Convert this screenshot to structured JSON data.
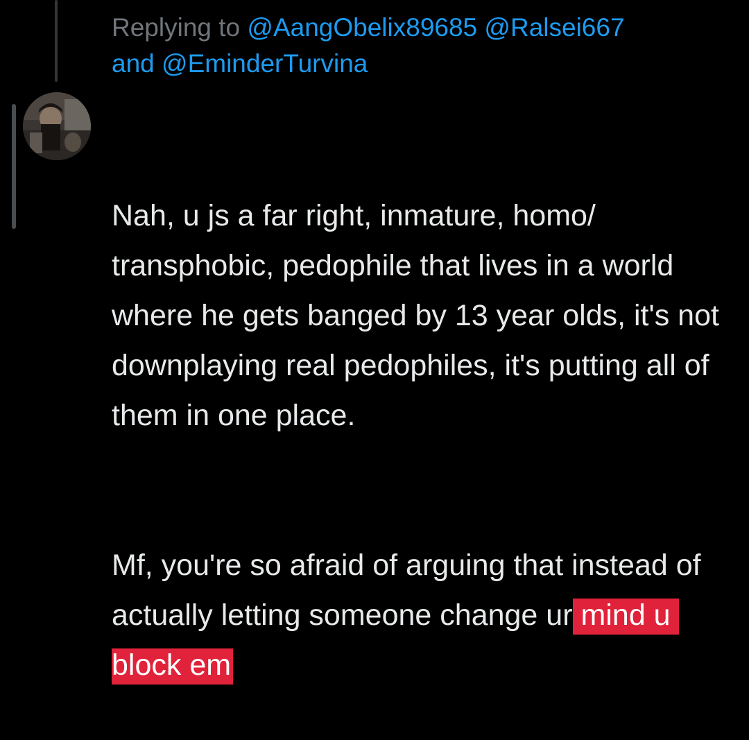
{
  "reply_context": {
    "prefix": "Replying to",
    "mention_1": "@AangObelix89685",
    "mention_2": "@Ralsei667",
    "joiner": "and",
    "mention_3": "@EminderTurvina"
  },
  "tweet": {
    "paragraph_1": "Nah, u js a far right, inmature, homo/ transphobic, pedophile that lives in a world where he gets banged by 13 year olds, it's not downplaying real pedophiles, it's putting all of them in one place.",
    "paragraph_2_plain": "Mf, you're so afraid of arguing that instead of actually letting someone change ur",
    "paragraph_2_highlighted": "mind u block em"
  },
  "colors": {
    "background": "#000000",
    "text": "#e7e9ea",
    "muted": "#71767b",
    "mention": "#1d9bf0",
    "highlight": "#e0223a"
  }
}
